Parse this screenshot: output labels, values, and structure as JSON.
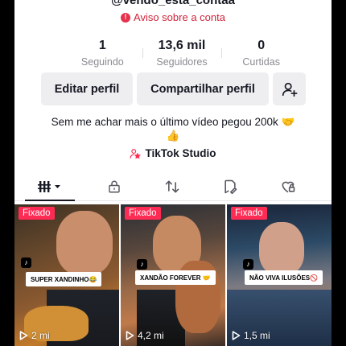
{
  "profile": {
    "username": "@vendo_esta_contaa",
    "warning_text": "Aviso sobre a conta"
  },
  "stats": [
    {
      "value": "1",
      "label": "Seguindo"
    },
    {
      "value": "13,6 mil",
      "label": "Seguidores"
    },
    {
      "value": "0",
      "label": "Curtidas"
    }
  ],
  "actions": {
    "edit_label": "Editar perfil",
    "share_label": "Compartilhar perfil",
    "add_friend_icon": "add-user-icon"
  },
  "bio": {
    "line1": "Sem me achar mais o último vídeo pegou 200k 🤝",
    "line2": "👍"
  },
  "studio": {
    "label": "TikTok Studio"
  },
  "tabs": [
    {
      "icon": "videos-grid-icon",
      "active": true
    },
    {
      "icon": "lock-icon"
    },
    {
      "icon": "repost-icon"
    },
    {
      "icon": "saved-icon"
    },
    {
      "icon": "liked-icon"
    }
  ],
  "videos": [
    {
      "badge": "Fixado",
      "caption": "SUPER XANDINHO😂",
      "views": "2 mi"
    },
    {
      "badge": "Fixado",
      "caption": "XANDÃO FOREVER 🤝",
      "views": "4,2 mi"
    },
    {
      "badge": "Fixado",
      "caption": "NÃO VIVA ILUSÕES🚫",
      "views": "1,5 mi"
    }
  ],
  "colors": {
    "accent": "#fe2c55",
    "warning": "#d0243a",
    "button_bg": "#eeeef0",
    "muted_text": "#8a8b91"
  }
}
